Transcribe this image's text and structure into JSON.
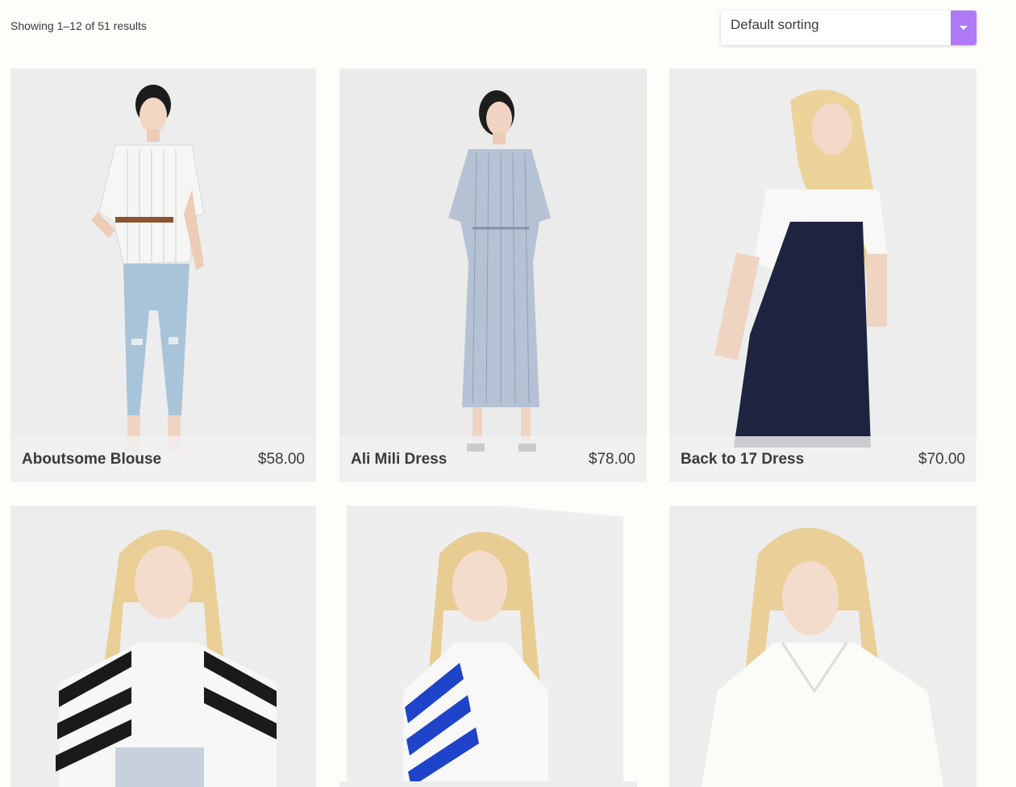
{
  "toolbar": {
    "result_count": "Showing 1–12 of 51 results",
    "sort": {
      "selected": "Default sorting",
      "accent_color": "#b07af7",
      "icon": "chevron-down-icon"
    }
  },
  "products": [
    {
      "name": "Aboutsome Blouse",
      "price": "$58.00"
    },
    {
      "name": "Ali Mili Dress",
      "price": "$78.00"
    },
    {
      "name": "Back to 17 Dress",
      "price": "$70.00"
    },
    {
      "name": "",
      "price": ""
    },
    {
      "name": "",
      "price": ""
    },
    {
      "name": "",
      "price": ""
    }
  ]
}
